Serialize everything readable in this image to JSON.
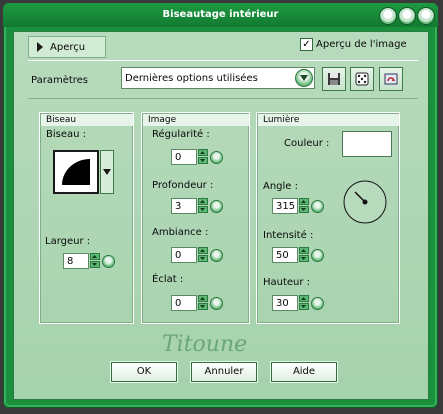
{
  "window": {
    "title": "Biseautage intérieur"
  },
  "preview": {
    "toggle_label": "Aperçu",
    "checkbox_label": "Aperçu de l'image",
    "checked": true
  },
  "params": {
    "label": "Paramètres",
    "preset_value": "Dernières options utilisées"
  },
  "toolbar_icons": [
    "save-icon",
    "dice-icon",
    "reset-icon"
  ],
  "groups": {
    "bevel": {
      "title": "Biseau",
      "bevel_label": "Biseau :",
      "width_label": "Largeur :",
      "width_value": "8"
    },
    "image": {
      "title": "Image",
      "fields": [
        {
          "label": "Régularité :",
          "value": "0"
        },
        {
          "label": "Profondeur :",
          "value": "3"
        },
        {
          "label": "Ambiance :",
          "value": "0"
        },
        {
          "label": "Éclat :",
          "value": "0"
        }
      ]
    },
    "light": {
      "title": "Lumière",
      "color_label": "Couleur :",
      "color_value": "#ffffff",
      "fields": [
        {
          "label": "Angle :",
          "value": "315"
        },
        {
          "label": "Intensité :",
          "value": "50"
        },
        {
          "label": "Hauteur :",
          "value": "30"
        }
      ]
    }
  },
  "watermark": "Titoune",
  "buttons": {
    "ok": "OK",
    "cancel": "Annuler",
    "help": "Aide"
  },
  "colors": {
    "frame": "#1a8f3c",
    "client": "#b2d8b8",
    "accent": "#5cb872"
  }
}
